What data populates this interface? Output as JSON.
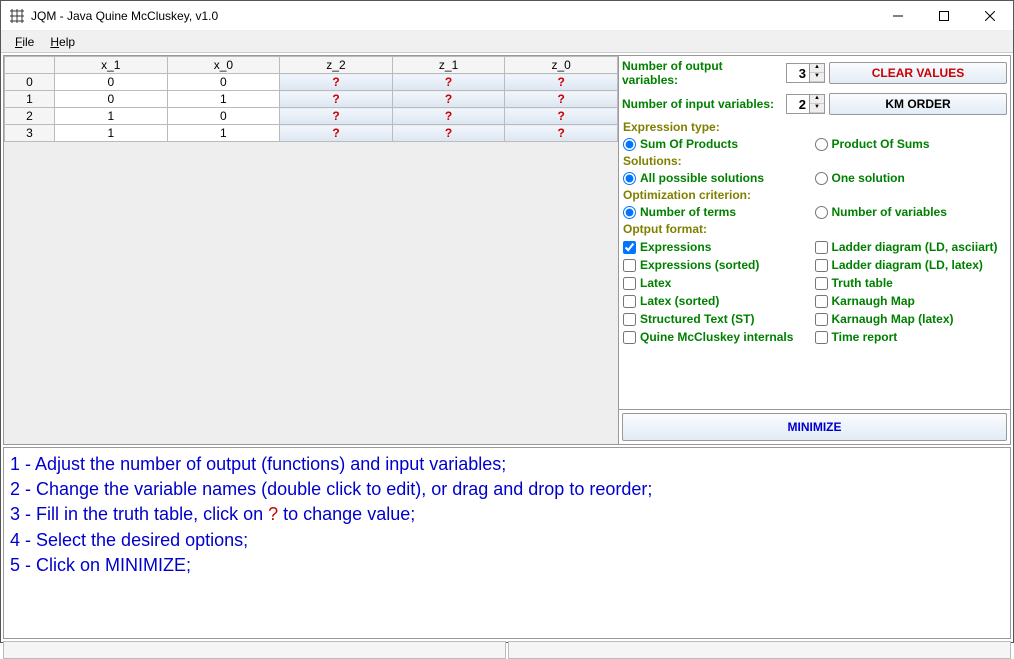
{
  "window": {
    "title": "JQM - Java Quine McCluskey, v1.0",
    "app_icon": "grid-icon"
  },
  "menu": {
    "file": "File",
    "help": "Help"
  },
  "table": {
    "inputs": [
      "x_1",
      "x_0"
    ],
    "outputs": [
      "z_2",
      "z_1",
      "z_0"
    ],
    "rows": [
      {
        "idx": "0",
        "x": [
          "0",
          "0"
        ],
        "z": [
          "?",
          "?",
          "?"
        ]
      },
      {
        "idx": "1",
        "x": [
          "0",
          "1"
        ],
        "z": [
          "?",
          "?",
          "?"
        ]
      },
      {
        "idx": "2",
        "x": [
          "1",
          "0"
        ],
        "z": [
          "?",
          "?",
          "?"
        ]
      },
      {
        "idx": "3",
        "x": [
          "1",
          "1"
        ],
        "z": [
          "?",
          "?",
          "?"
        ]
      }
    ]
  },
  "controls": {
    "num_output_label": "Number of output variables:",
    "num_output_value": "3",
    "num_input_label": "Number  of  input  variables:",
    "num_input_value": "2",
    "clear_btn": "CLEAR VALUES",
    "km_btn": "KM ORDER",
    "expr_type_label": "Expression type:",
    "sop": "Sum Of Products",
    "pos": "Product Of Sums",
    "solutions_label": "Solutions:",
    "all_sol": "All possible solutions",
    "one_sol": "One solution",
    "opt_crit_label": "Optimization criterion:",
    "num_terms": "Number of terms",
    "num_vars": "Number of variables",
    "output_fmt_label": "Optput format:",
    "fmt": {
      "expr": "Expressions",
      "ld_ascii": "Ladder diagram (LD, asciiart)",
      "expr_sorted": "Expressions (sorted)",
      "ld_latex": "Ladder diagram (LD, latex)",
      "latex": "Latex",
      "truth_table": "Truth table",
      "latex_sorted": "Latex (sorted)",
      "kmap": "Karnaugh Map",
      "st": "Structured Text (ST)",
      "kmap_latex": "Karnaugh Map (latex)",
      "qm_int": "Quine McCluskey internals",
      "time": "Time report"
    },
    "minimize_btn": "MINIMIZE"
  },
  "instructions": {
    "l1a": "1 - Adjust the number of output (functions) and input variables;",
    "l2a": "2 - Change the variable names (double click to edit), or drag and drop to reorder;",
    "l3a": "3 - Fill in the truth table, click on ",
    "l3q": "?",
    "l3b": " to change value;",
    "l4": "4 - Select the desired options;",
    "l5": "5 - Click on MINIMIZE;"
  }
}
